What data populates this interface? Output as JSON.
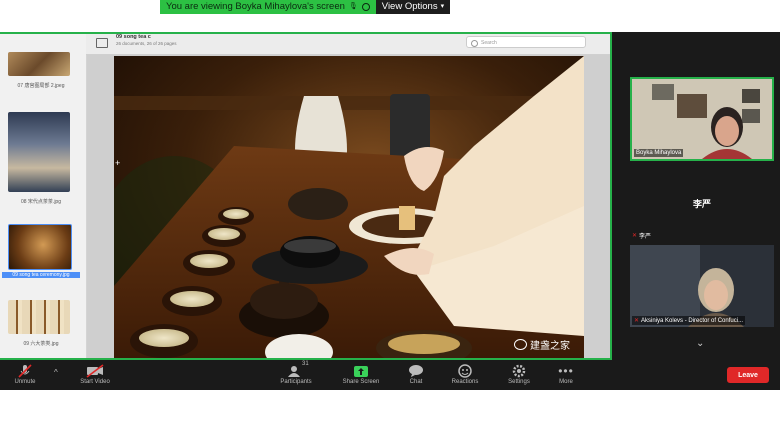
{
  "window_title": "",
  "banner": {
    "viewing_text": "You are viewing Boyka Mihaylova's screen",
    "view_options": "View Options"
  },
  "document": {
    "title": "09 song tea c",
    "subtitle": "26 documents, 26 of 26 pages",
    "search_placeholder": "Search"
  },
  "thumbnails": [
    {
      "label": "07 唐宫图局部 2.jpeg"
    },
    {
      "label": "08 宋代点茶茶.jpg"
    },
    {
      "label": "09 song tea ceremony.jpg",
      "selected": true
    },
    {
      "label": "09 六大茶类.jpg"
    }
  ],
  "photo_watermark": "建盏之家",
  "participants": [
    {
      "name": "Boyka Mihaylova",
      "type": "video"
    },
    {
      "name": "李严",
      "type": "name_only",
      "small_label": "李严"
    },
    {
      "name": "Aksiniya Kolevs - Director of Confuci...",
      "type": "video"
    }
  ],
  "toolbar": {
    "unmute": "Unmute",
    "start_video": "Start Video",
    "participants": "Participants",
    "participants_count": "31",
    "share_screen": "Share Screen",
    "chat": "Chat",
    "reactions": "Reactions",
    "settings": "Settings",
    "more": "More",
    "leave": "Leave"
  },
  "colors": {
    "share_border": "#26b14a",
    "viewing_green": "#2cc043",
    "leave_red": "#e02828",
    "share_screen_icon": "#3ad15a"
  }
}
